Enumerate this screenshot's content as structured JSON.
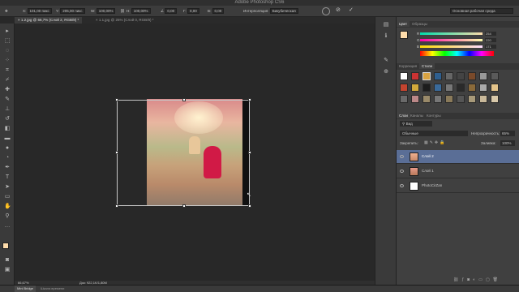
{
  "window": {
    "title": "Adobe Photoshop CS6"
  },
  "options_bar": {
    "x_label": "X:",
    "x_value": "101,00 пикс",
    "y_label": "Y:",
    "y_value": "205,00 пикс",
    "w_label": "W:",
    "w_value": "100,00%",
    "h_label": "H:",
    "h_value": "100,00%",
    "angle_value": "0,00",
    "hskew_label": "Г:",
    "hskew_value": "0,00",
    "vskew_label": "В:",
    "vskew_value": "0,00",
    "interpolation_label": "Интерполяция:",
    "interpolation_value": "Бикубическая",
    "workspace_value": "Основная рабочая среда"
  },
  "tabs": [
    {
      "label": "1.2.jpg @ 66,7% (Слой 2, RGB/8) *",
      "close": "×"
    },
    {
      "label": "1.1.jpg @ 25% (Слой 0, RGB/8) *",
      "close": "×"
    }
  ],
  "status": {
    "zoom": "66,67%",
    "doc": "Док: 922,1K/1,80M"
  },
  "bottom": {
    "minibridge": "Mini Bridge",
    "timeline": "Шкала времени"
  },
  "color_panel": {
    "tabs": [
      "Цвет",
      "Образцы"
    ],
    "r_label": "R",
    "r_value": "254",
    "g_label": "G",
    "g_value": "220",
    "b_label": "B",
    "b_value": "171",
    "fg_color": "#fedcab"
  },
  "adjust_panel": {
    "tabs": [
      "Коррекция",
      "Стили"
    ]
  },
  "layers_panel": {
    "tabs": [
      "Слои",
      "Каналы",
      "Контуры"
    ],
    "kind_label": "Вид",
    "blend_mode": "Обычные",
    "opacity_label": "Непрозрачность:",
    "opacity_value": "65%",
    "lock_label": "Закрепить:",
    "fill_label": "Заливка:",
    "fill_value": "100%",
    "layers": [
      {
        "name": "Слой 2",
        "selected": true
      },
      {
        "name": "Слой 1",
        "selected": false
      },
      {
        "name": "PhotoCirZan",
        "selected": false
      }
    ]
  }
}
